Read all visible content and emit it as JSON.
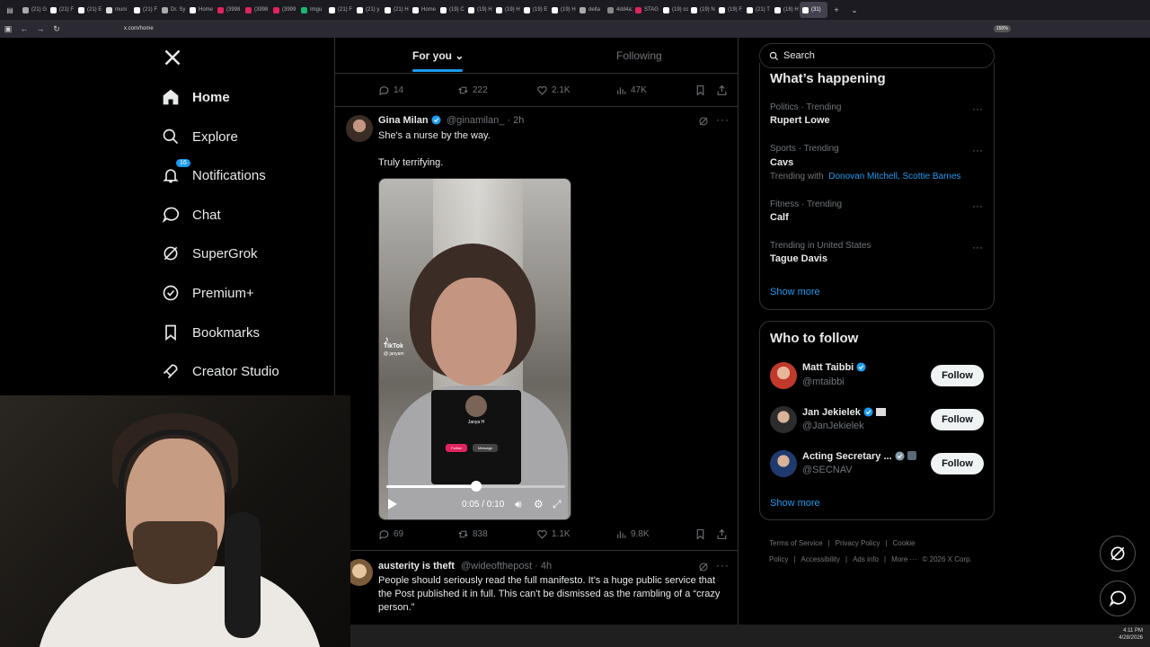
{
  "browser": {
    "tabs": [
      {
        "label": "(21) G",
        "fav": "#aaa"
      },
      {
        "label": "(21) F",
        "fav": "#fff"
      },
      {
        "label": "(21) E",
        "fav": "#fff"
      },
      {
        "label": "muni",
        "fav": "#ddd"
      },
      {
        "label": "(21) F",
        "fav": "#fff"
      },
      {
        "label": "Dr. Sy",
        "fav": "#aaa"
      },
      {
        "label": "Home",
        "fav": "#fff"
      },
      {
        "label": "(3998",
        "fav": "#e0245e"
      },
      {
        "label": "(3998",
        "fav": "#e0245e"
      },
      {
        "label": "(3999",
        "fav": "#e0245e"
      },
      {
        "label": "Imgu",
        "fav": "#1bb76e"
      },
      {
        "label": "(21) F",
        "fav": "#fff"
      },
      {
        "label": "(21) y",
        "fav": "#fff"
      },
      {
        "label": "(21) H",
        "fav": "#fff"
      },
      {
        "label": "Home",
        "fav": "#fff"
      },
      {
        "label": "(19) C",
        "fav": "#fff"
      },
      {
        "label": "(19) H",
        "fav": "#fff"
      },
      {
        "label": "(19) H",
        "fav": "#fff"
      },
      {
        "label": "(19) E",
        "fav": "#fff"
      },
      {
        "label": "(19) H",
        "fav": "#fff"
      },
      {
        "label": "delta",
        "fav": "#aaa"
      },
      {
        "label": "4dd4a14",
        "fav": "#888"
      },
      {
        "label": "STAG",
        "fav": "#e0245e"
      },
      {
        "label": "(19) cc",
        "fav": "#fff"
      },
      {
        "label": "(19) N",
        "fav": "#fff"
      },
      {
        "label": "(19) F",
        "fav": "#fff"
      },
      {
        "label": "(21) T",
        "fav": "#fff"
      },
      {
        "label": "(18) H",
        "fav": "#fff"
      },
      {
        "label": "(31)",
        "fav": "#fff",
        "active": true
      }
    ],
    "url": "x.com/home",
    "zoom": "150%"
  },
  "nav": {
    "logo": "X",
    "items": [
      {
        "label": "Home",
        "icon": "home-icon"
      },
      {
        "label": "Explore",
        "icon": "search-icon"
      },
      {
        "label": "Notifications",
        "icon": "bell-icon",
        "badge": "16"
      },
      {
        "label": "Chat",
        "icon": "chat-icon"
      },
      {
        "label": "SuperGrok",
        "icon": "grok-icon"
      },
      {
        "label": "Premium+",
        "icon": "verified-icon"
      },
      {
        "label": "Bookmarks",
        "icon": "bookmark-icon"
      },
      {
        "label": "Creator Studio",
        "icon": "rocket-icon"
      }
    ]
  },
  "feed": {
    "tabs": {
      "for_you": "For you",
      "following": "Following"
    },
    "prev_tweet_stats": {
      "replies": "14",
      "reposts": "222",
      "likes": "2.1K",
      "views": "47K"
    },
    "tweet1": {
      "name": "Gina Milan",
      "handle": "@ginamilan_",
      "time": "· 2h",
      "line1": "She's a nurse by the way.",
      "line2": "Truly terrifying.",
      "video": {
        "watermark": "TikTok",
        "watermark_handle": "@ janyam",
        "inset_name": "Janya H",
        "inset_follow": "Follow",
        "inset_message": "Message",
        "time": "0:05 / 0:10",
        "progress": 0.5
      },
      "stats": {
        "replies": "69",
        "reposts": "838",
        "likes": "1.1K",
        "views": "9.8K"
      }
    },
    "tweet2": {
      "name": "austerity is theft",
      "handle": "@wideofthepost",
      "time": "· 4h",
      "text": "People should seriously read the full manifesto. It's a huge public service that the Post published it in full. This can't be dismissed as the rambling of a “crazy person.”"
    }
  },
  "right": {
    "search_placeholder": "Search",
    "trends_title": "What’s happening",
    "trends": [
      {
        "meta": "Politics · Trending",
        "name": "Rupert Lowe"
      },
      {
        "meta": "Sports · Trending",
        "name": "Cavs",
        "with_label": "Trending with",
        "with_links": "Donovan Mitchell, Scottie Barnes"
      },
      {
        "meta": "Fitness · Trending",
        "name": "Calf"
      },
      {
        "meta": "Trending in United States",
        "name": "Tague Davis"
      }
    ],
    "trends_show_more": "Show more",
    "wtf_title": "Who to follow",
    "wtf": [
      {
        "name": "Matt Taibbi",
        "handle": "@mtaibbi",
        "button": "Follow",
        "avatar_color": "#c0392b"
      },
      {
        "name": "Jan Jekielek",
        "handle": "@JanJekielek",
        "button": "Follow",
        "avatar_color": "#2c2c2c"
      },
      {
        "name": "Acting Secretary ...",
        "handle": "@SECNAV",
        "button": "Follow",
        "avatar_color": "#1f3a6e"
      }
    ],
    "wtf_show_more": "Show more",
    "footer": [
      "Terms of Service",
      "|",
      "Privacy Policy",
      "|",
      "Cookie Policy",
      "|",
      "Accessibility",
      "|",
      "Ads info",
      "|",
      "More ···",
      "© 2026 X Corp."
    ]
  },
  "taskbar": {
    "time": "4:11 PM",
    "date": "4/28/2026"
  },
  "colors": {
    "accent": "#1d9bf0",
    "background": "#000000",
    "border": "#2f3336",
    "muted": "#71767b"
  }
}
